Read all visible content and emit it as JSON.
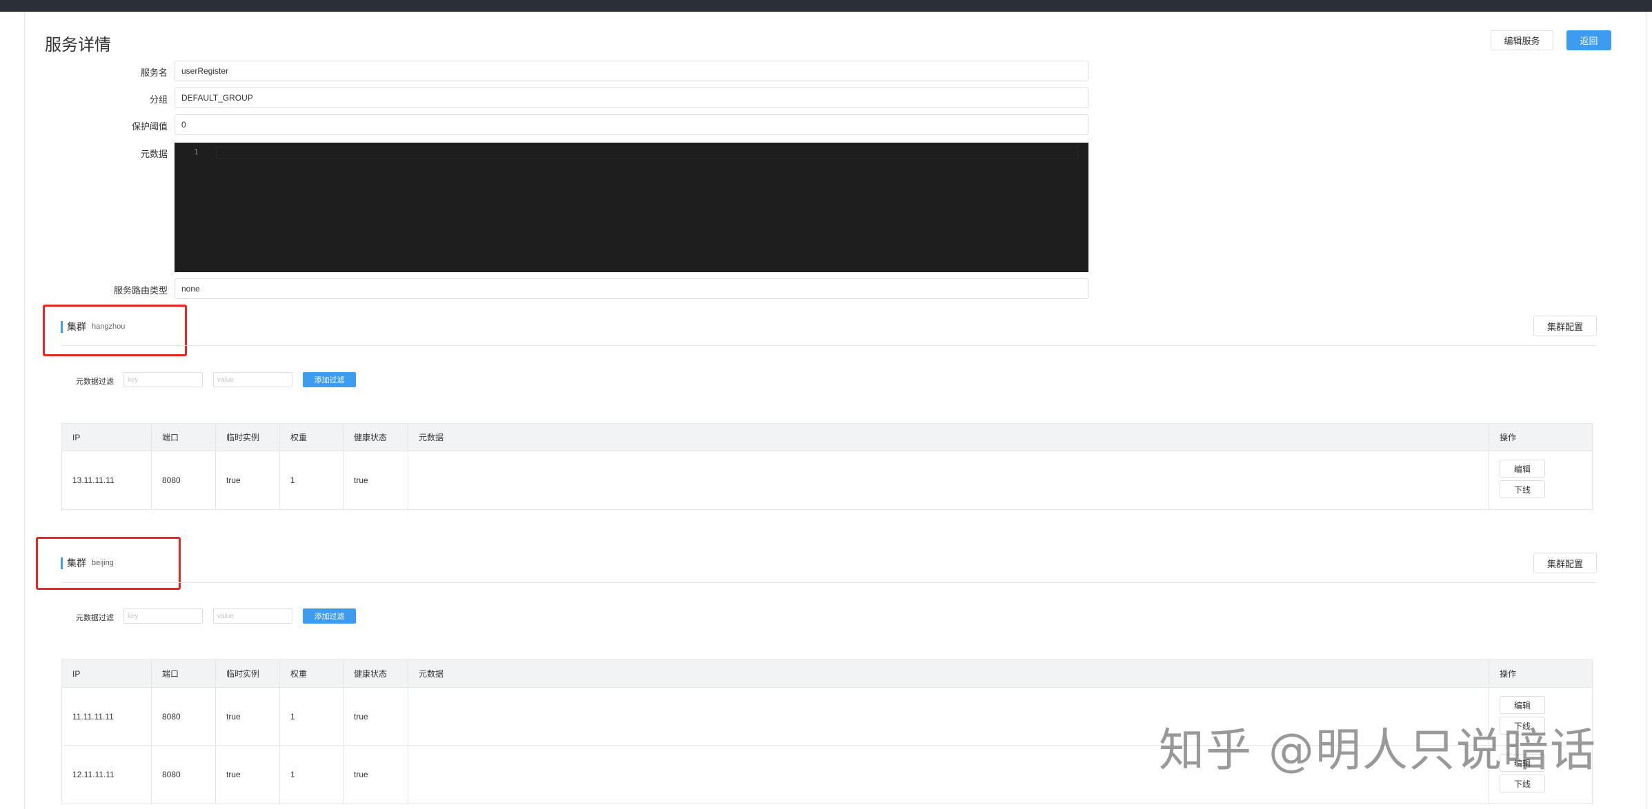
{
  "page": {
    "title": "服务详情",
    "edit_service_label": "编辑服务",
    "back_label": "返回"
  },
  "form": {
    "service_name_label": "服务名",
    "service_name_value": "userRegister",
    "group_label": "分组",
    "group_value": "DEFAULT_GROUP",
    "threshold_label": "保护阈值",
    "threshold_value": "0",
    "metadata_label": "元数据",
    "metadata_line_number": "1",
    "selector_label": "服务路由类型",
    "selector_value": "none"
  },
  "clusters": [
    {
      "title": "集群",
      "name": "hangzhou",
      "config_label": "集群配置",
      "filter_label": "元数据过滤",
      "key_placeholder": "key",
      "value_placeholder": "value",
      "add_filter_label": "添加过滤",
      "columns": [
        "IP",
        "端口",
        "临时实例",
        "权重",
        "健康状态",
        "元数据",
        "操作"
      ],
      "rows": [
        {
          "ip": "13.11.11.11",
          "port": "8080",
          "ephemeral": "true",
          "weight": "1",
          "healthy": "true",
          "metadata": "",
          "edit_label": "编辑",
          "offline_label": "下线"
        }
      ]
    },
    {
      "title": "集群",
      "name": "beijing",
      "config_label": "集群配置",
      "filter_label": "元数据过滤",
      "key_placeholder": "key",
      "value_placeholder": "value",
      "add_filter_label": "添加过滤",
      "columns": [
        "IP",
        "端口",
        "临时实例",
        "权重",
        "健康状态",
        "元数据",
        "操作"
      ],
      "rows": [
        {
          "ip": "11.11.11.11",
          "port": "8080",
          "ephemeral": "true",
          "weight": "1",
          "healthy": "true",
          "metadata": "",
          "edit_label": "编辑",
          "offline_label": "下线"
        },
        {
          "ip": "12.11.11.11",
          "port": "8080",
          "ephemeral": "true",
          "weight": "1",
          "healthy": "true",
          "metadata": "",
          "edit_label": "编辑",
          "offline_label": "下线"
        }
      ]
    }
  ],
  "watermark": "知乎 @明人只说暗话",
  "colors": {
    "primary": "#3e9cf0",
    "highlight_box": "#e8262a",
    "editor_bg": "#1e1e1e",
    "topbar": "#2b2f36"
  }
}
